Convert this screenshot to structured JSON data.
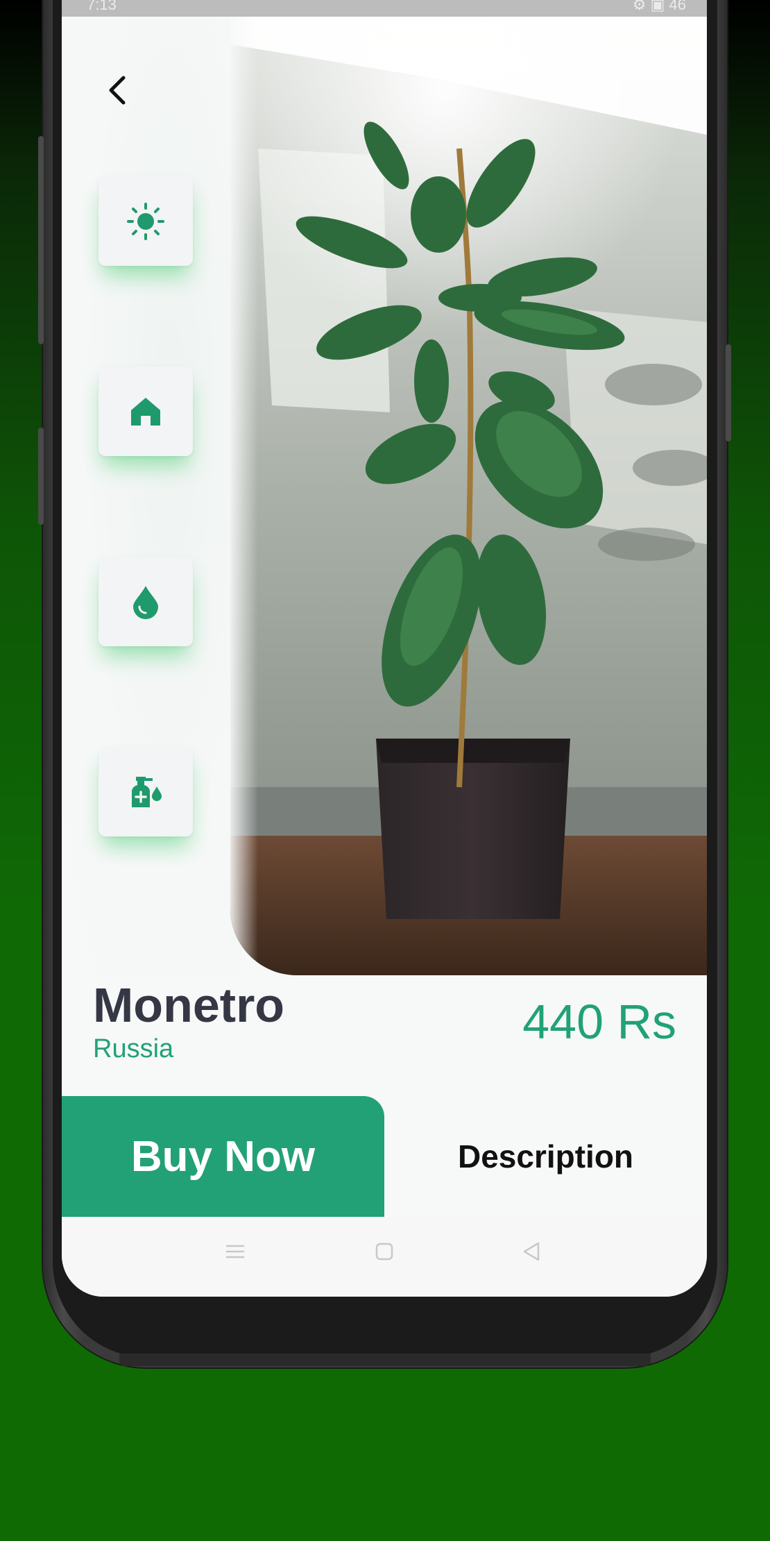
{
  "statusbar": {
    "time": "7:13",
    "right": "⚙ ▣ 46"
  },
  "product": {
    "name": "Monetro",
    "origin": "Russia",
    "price": "440 Rs"
  },
  "actions": {
    "buy_label": "Buy Now",
    "description_label": "Description"
  },
  "features": [
    {
      "icon": "sun-icon"
    },
    {
      "icon": "home-icon"
    },
    {
      "icon": "water-drop-icon"
    },
    {
      "icon": "spray-bottle-icon"
    }
  ],
  "colors": {
    "accent": "#23a176",
    "title": "#353844",
    "card": "#f3f4f6",
    "glow": "#2bc85a"
  },
  "navbar": {
    "items": [
      "menu-icon",
      "home-square-icon",
      "back-triangle-icon"
    ]
  }
}
